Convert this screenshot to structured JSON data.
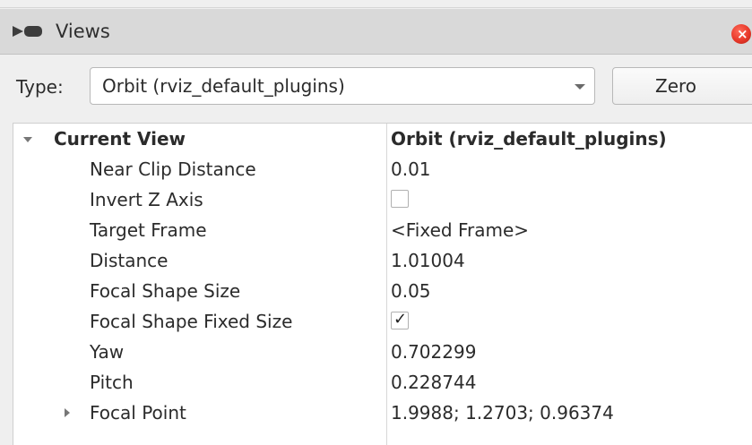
{
  "panel": {
    "title": "Views",
    "close_icon": "close-icon"
  },
  "type_bar": {
    "label": "Type:",
    "selected": "Orbit (rviz_default_plugins)",
    "zero_label": "Zero"
  },
  "tree": {
    "root": {
      "name": "Current View",
      "value": "Orbit (rviz_default_plugins)",
      "expanded": true
    },
    "rows": [
      {
        "name": "Near Clip Distance",
        "value": "0.01"
      },
      {
        "name": "Invert Z Axis",
        "checked": false
      },
      {
        "name": "Target Frame",
        "value": "<Fixed Frame>"
      },
      {
        "name": "Distance",
        "value": "1.01004"
      },
      {
        "name": "Focal Shape Size",
        "value": "0.05"
      },
      {
        "name": "Focal Shape Fixed Size",
        "checked": true,
        "check_glyph": "✓"
      },
      {
        "name": "Yaw",
        "value": "0.702299"
      },
      {
        "name": "Pitch",
        "value": "0.228744"
      },
      {
        "name": "Focal Point",
        "value": "1.9988; 1.2703; 0.96374",
        "expanded": false
      }
    ]
  },
  "colors": {
    "titlebar": "#d9d9d9",
    "close_red": "#e8392a",
    "tree_bg": "#ffffff"
  }
}
